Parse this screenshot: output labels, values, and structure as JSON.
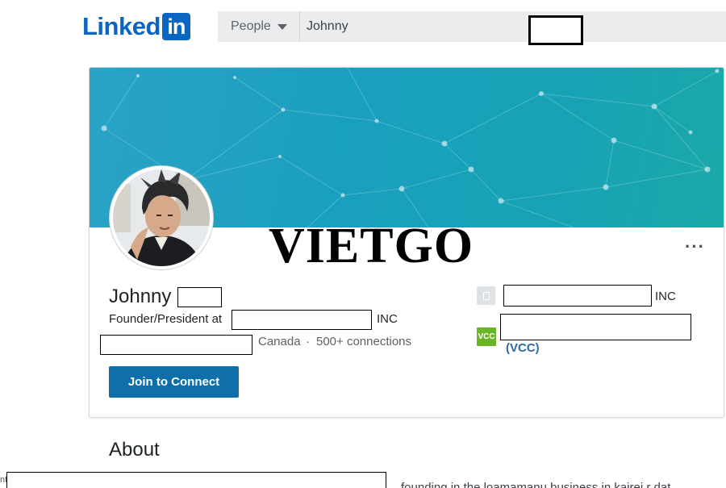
{
  "header": {
    "logo_text": "Linked",
    "logo_in": "in",
    "search_type": "People",
    "search_value": "Johnny"
  },
  "watermark": "VIETGO",
  "profile": {
    "name": "Johnny",
    "headline_prefix": "Founder/President at",
    "headline_suffix": "INC",
    "location": "Canada",
    "separator": "·",
    "connections": "500+ connections",
    "join_button": "Join to Connect",
    "more_menu": "···"
  },
  "sidebar": {
    "company_suffix": "INC",
    "education_icon_label": "VCC",
    "education_text": "(VCC)"
  },
  "about": {
    "heading": "About",
    "left_fragment": "nt",
    "text": "founding in the loamamanu business in kairei r dat"
  },
  "colors": {
    "brand": "#0a66c2",
    "button": "#0f6fab",
    "banner_start": "#2aa3c6",
    "banner_end": "#1aa9a8",
    "vcc_green": "#6bb42a",
    "link": "#2e6aa5"
  }
}
